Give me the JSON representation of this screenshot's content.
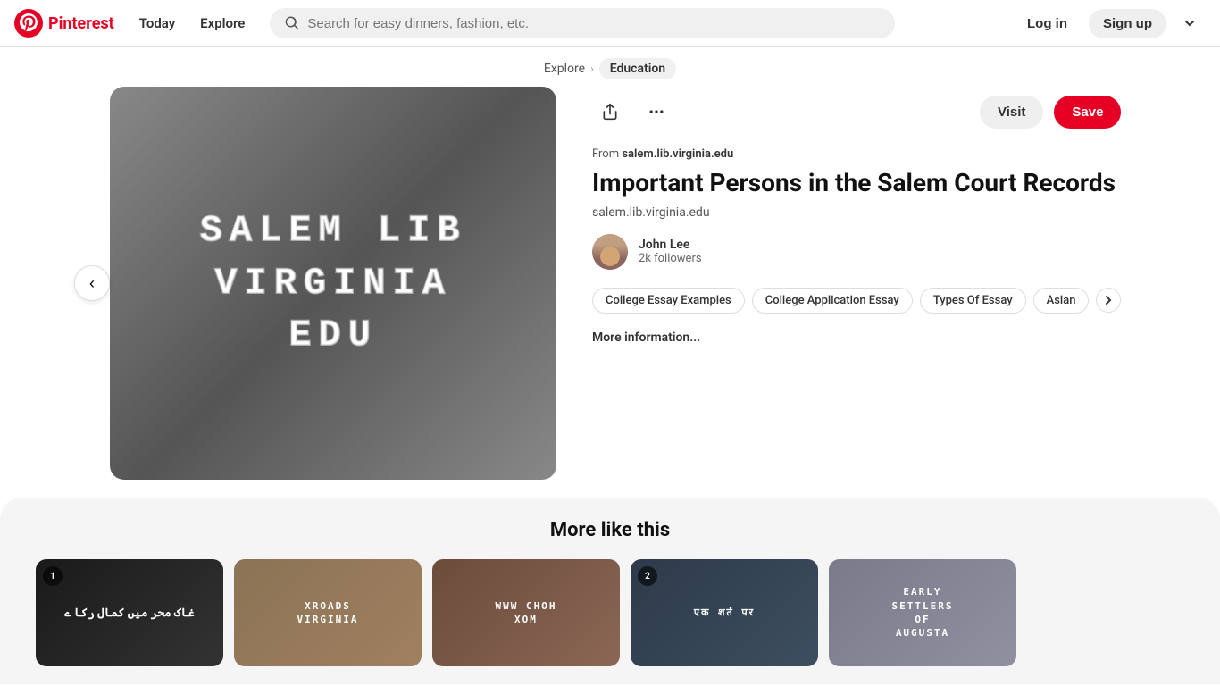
{
  "header": {
    "logo_text": "Pinterest",
    "nav": {
      "today": "Today",
      "explore": "Explore"
    },
    "search_placeholder": "Search for easy dinners, fashion, etc.",
    "login_label": "Log in",
    "signup_label": "Sign up"
  },
  "breadcrumb": {
    "explore": "Explore",
    "current": "Education"
  },
  "pin": {
    "from_label": "From",
    "source_domain": "salem.lib.virginia.edu",
    "title": "Important Persons in the Salem Court Records",
    "pin_domain": "salem.lib.virginia.edu",
    "author_name": "John Lee",
    "author_followers": "2k followers",
    "visit_label": "Visit",
    "save_label": "Save",
    "tags": [
      "College Essay Examples",
      "College Application Essay",
      "Types Of Essay",
      "Asian"
    ],
    "more_info": "More information...",
    "image_lines": [
      "SALEM LIB",
      "VIRGINIA",
      "EDU"
    ]
  },
  "more_section": {
    "title": "More like this",
    "cards": [
      {
        "bg": "dark",
        "text": "غاک محر میں کمال رکا ے",
        "urdu": true,
        "badge": "1"
      },
      {
        "bg": "tan",
        "text": "XROADS VIRGINIA",
        "urdu": false,
        "badge": null
      },
      {
        "bg": "brown",
        "text": "WWW CHOH XOM",
        "urdu": false,
        "badge": null
      },
      {
        "bg": "slate",
        "text": "एक शर्त पर",
        "urdu": false,
        "badge": "2"
      },
      {
        "bg": "gray",
        "text": "EARLY SETTLERS OF AUGUSTA",
        "urdu": false,
        "badge": null
      }
    ]
  }
}
